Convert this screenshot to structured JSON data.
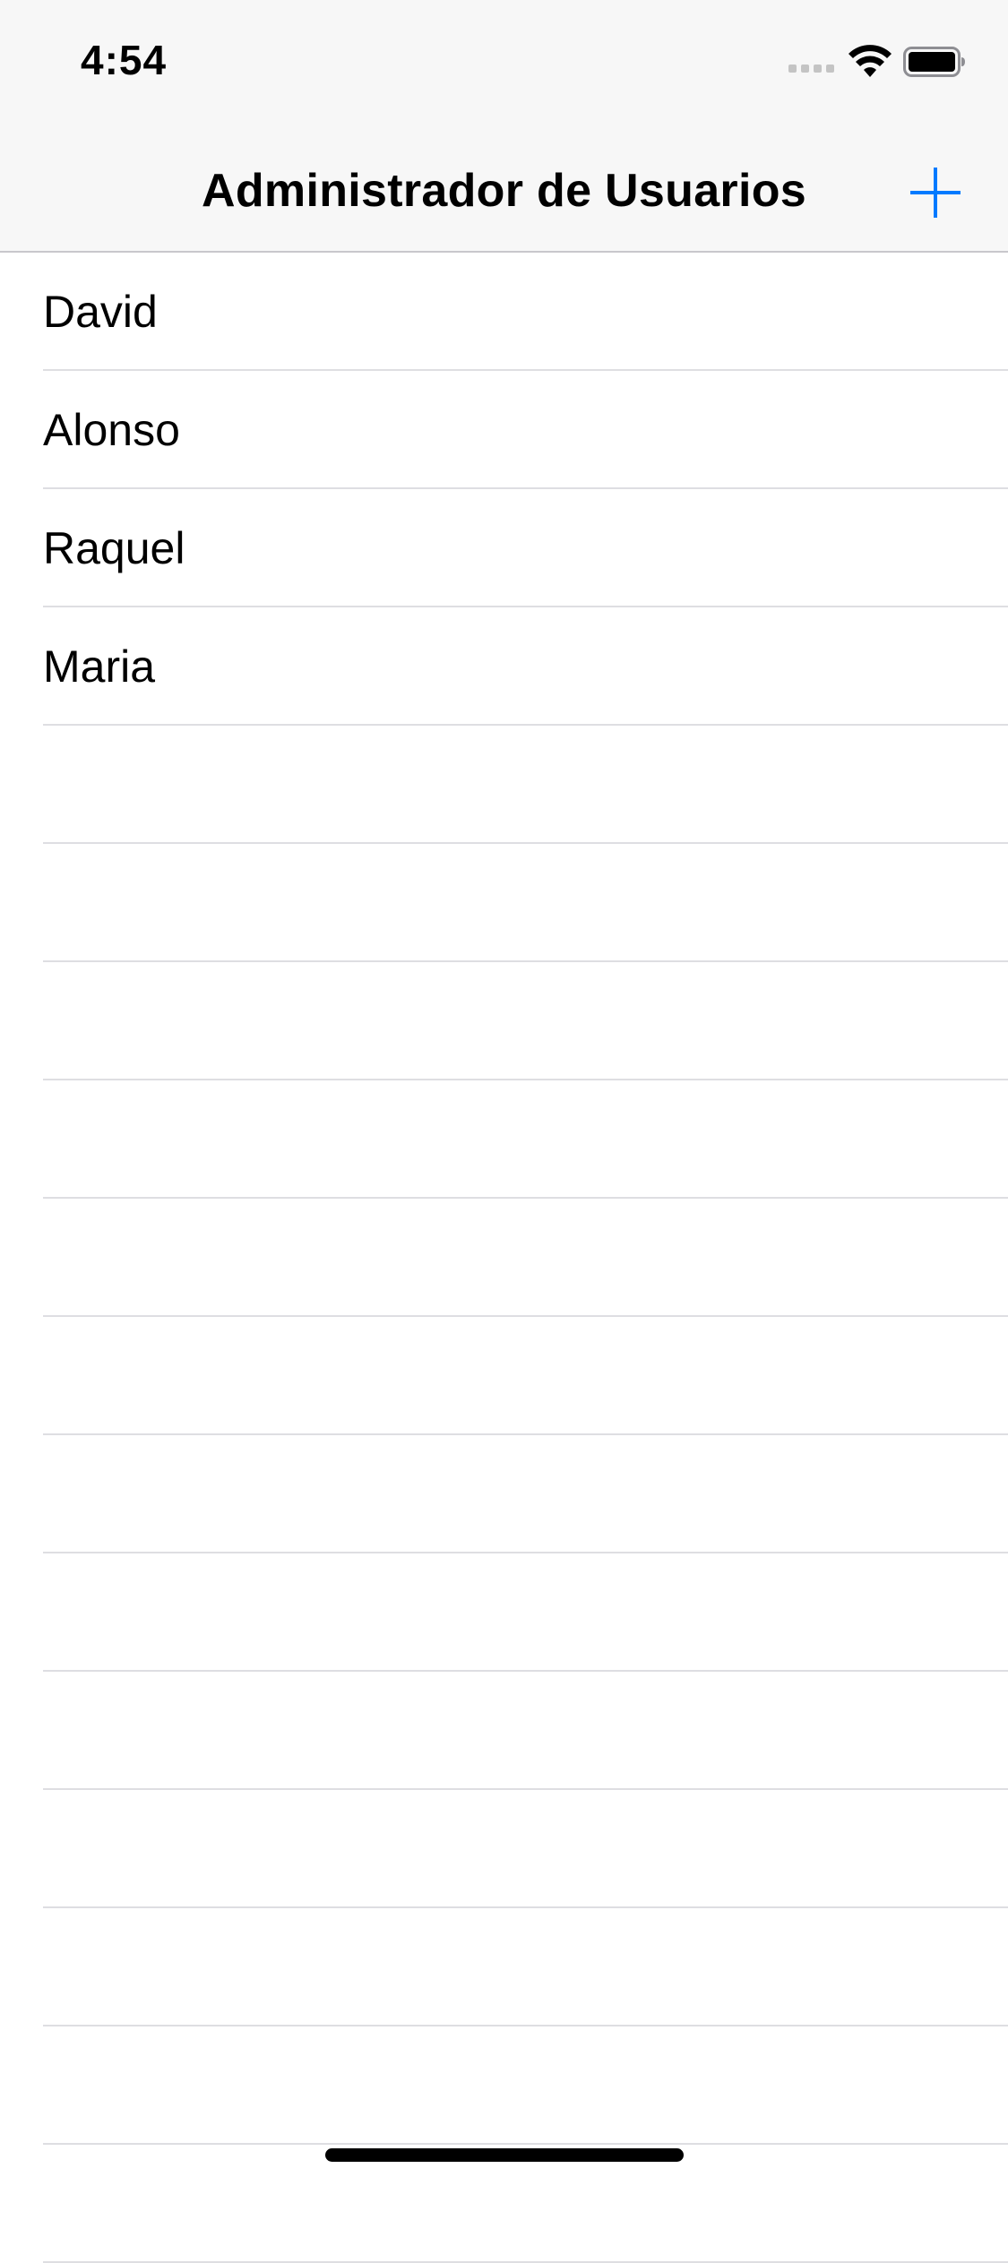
{
  "status_bar": {
    "time": "4:54",
    "signal_icon": "cellular-signal-icon",
    "wifi_icon": "wifi-icon",
    "battery_icon": "battery-icon"
  },
  "nav_bar": {
    "title": "Administrador de Usuarios",
    "add_icon": "plus-icon",
    "accent_color": "#007aff"
  },
  "users": [
    {
      "name": "David"
    },
    {
      "name": "Alonso"
    },
    {
      "name": "Raquel"
    },
    {
      "name": "Maria"
    },
    {
      "name": ""
    },
    {
      "name": ""
    },
    {
      "name": ""
    },
    {
      "name": ""
    },
    {
      "name": ""
    },
    {
      "name": ""
    },
    {
      "name": ""
    },
    {
      "name": ""
    },
    {
      "name": ""
    },
    {
      "name": ""
    },
    {
      "name": ""
    },
    {
      "name": ""
    },
    {
      "name": ""
    }
  ]
}
